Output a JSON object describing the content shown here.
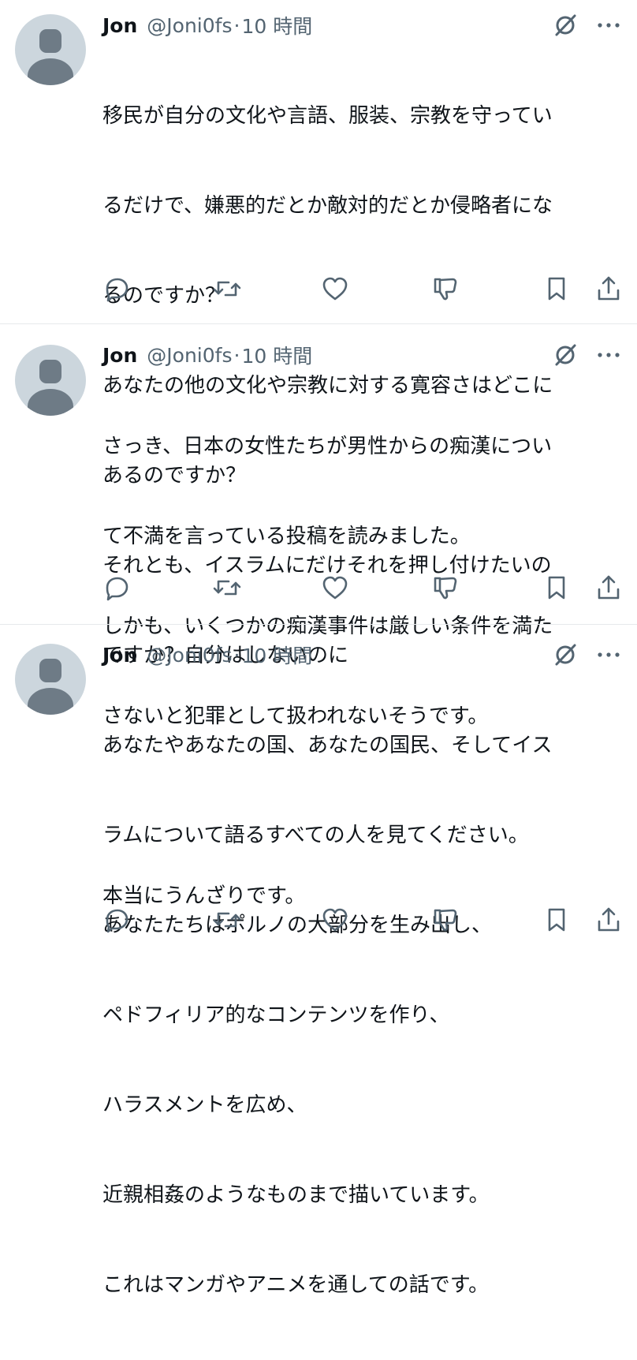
{
  "tweets": [
    {
      "author": "Jon",
      "handle": "@Joni0fs",
      "separator": "·",
      "time": "10 時間",
      "lines": [
        "移民が自分の文化や言語、服装、宗教を守ってい",
        "るだけで、嫌悪的だとか敵対的だとか侵略者にな",
        "るのですか？",
        "あなたの他の文化や宗教に対する寛容さはどこに",
        "あるのですか？",
        "それとも、イスラムにだけそれを押し付けたいの",
        "ですか？自分はしないのに"
      ]
    },
    {
      "author": "Jon",
      "handle": "@Joni0fs",
      "separator": "·",
      "time": "10 時間",
      "lines": [
        "さっき、日本の女性たちが男性からの痴漢につい",
        "て不満を言っている投稿を読みました。",
        "しかも、いくつかの痴漢事件は厳しい条件を満た",
        "さないと犯罪として扱われないそうです。",
        "",
        "本当にうんざりです。"
      ]
    },
    {
      "author": "Jon",
      "handle": "@Joni0fs",
      "separator": "·",
      "time": "10 時間",
      "lines": [
        "あなたやあなたの国、あなたの国民、そしてイス",
        "ラムについて語るすべての人を見てください。",
        "あなたたちはポルノの大部分を生み出し、",
        "ペドフィリア的なコンテンツを作り、",
        "ハラスメントを広め、",
        "近親相姦のようなものまで描いています。",
        "これはマンガやアニメを通しての話です。"
      ]
    }
  ],
  "icons": {
    "avatar": "default-avatar-icon",
    "grok": "grok-icon",
    "more": "more-options-icon",
    "reply": "reply-icon",
    "retweet": "retweet-icon",
    "like": "like-icon",
    "dislike": "dislike-icon",
    "bookmark": "bookmark-icon",
    "share": "share-icon"
  },
  "colors": {
    "text": "#0f1419",
    "secondary": "#536471",
    "divider": "#e6e9ec",
    "avatar_bg": "#ccd6dd",
    "avatar_fg": "#6e7b86"
  }
}
